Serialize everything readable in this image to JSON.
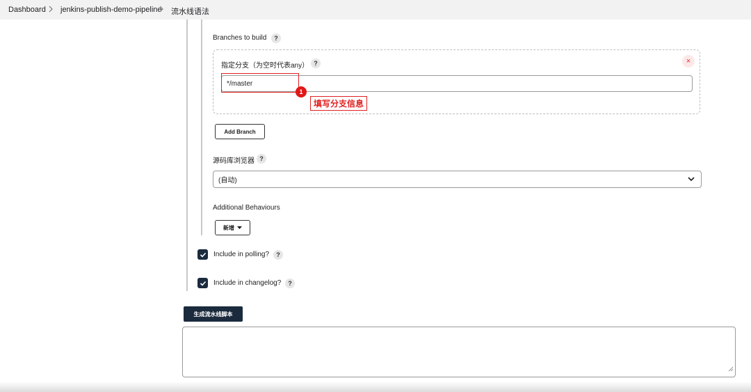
{
  "breadcrumb": {
    "items": [
      "Dashboard",
      "jenkins-publish-demo-pipeline",
      "流水线语法"
    ]
  },
  "help_symbol": "?",
  "branches": {
    "section_label": "Branches to build",
    "specifier_label": "指定分支（为空时代表any）",
    "specifier_value": "*/master",
    "close_symbol": "×",
    "add_branch_label": "Add Branch"
  },
  "annotation": {
    "number": "1",
    "text": "填写分支信息"
  },
  "browser": {
    "label": "源码库浏览器",
    "selected": "(自动)"
  },
  "behaviours": {
    "label": "Additional Behaviours",
    "add_label": "新增"
  },
  "options": {
    "polling_label": "Include in polling?",
    "changelog_label": "Include in changelog?"
  },
  "generate_button_label": "生成流水线脚本",
  "icons": {
    "chevron": "chevron-right-icon",
    "help": "help-icon",
    "close": "close-icon",
    "dropdown": "chevron-down-icon",
    "caret": "caret-down-icon",
    "check": "check-icon"
  },
  "colors": {
    "primary": "#1b2a3d",
    "annotation": "#e02020",
    "breadcrumb_bg": "#f2f2f3"
  }
}
